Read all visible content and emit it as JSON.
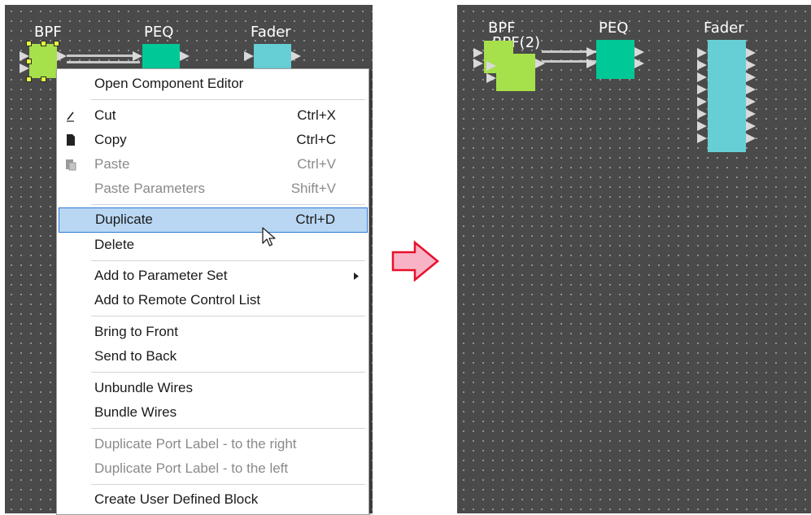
{
  "left_canvas": {
    "blocks": [
      {
        "id": "bpf",
        "label": "BPF",
        "color": "#a6e04a"
      },
      {
        "id": "peq",
        "label": "PEQ",
        "color": "#00c896"
      },
      {
        "id": "fader",
        "label": "Fader",
        "color": "#66cfd6"
      }
    ]
  },
  "context_menu": {
    "items": [
      {
        "label": "Open Component Editor",
        "shortcut": "",
        "disabled": false,
        "icon": ""
      },
      {
        "label": "Cut",
        "shortcut": "Ctrl+X",
        "disabled": false,
        "icon": "cut-icon"
      },
      {
        "label": "Copy",
        "shortcut": "Ctrl+C",
        "disabled": false,
        "icon": "copy-icon"
      },
      {
        "label": "Paste",
        "shortcut": "Ctrl+V",
        "disabled": true,
        "icon": "paste-icon"
      },
      {
        "label": "Paste Parameters",
        "shortcut": "Shift+V",
        "disabled": true,
        "icon": ""
      },
      {
        "label": "Duplicate",
        "shortcut": "Ctrl+D",
        "disabled": false,
        "highlighted": true,
        "icon": ""
      },
      {
        "label": "Delete",
        "shortcut": "",
        "disabled": false,
        "icon": ""
      },
      {
        "label": "Add to Parameter Set",
        "shortcut": "",
        "disabled": false,
        "submenu": true,
        "icon": "submenu-arrow-icon"
      },
      {
        "label": "Add to Remote Control List",
        "shortcut": "",
        "disabled": false,
        "icon": ""
      },
      {
        "label": "Bring to Front",
        "shortcut": "",
        "disabled": false,
        "icon": ""
      },
      {
        "label": "Send to Back",
        "shortcut": "",
        "disabled": false,
        "icon": ""
      },
      {
        "label": "Unbundle Wires",
        "shortcut": "",
        "disabled": false,
        "icon": ""
      },
      {
        "label": "Bundle Wires",
        "shortcut": "",
        "disabled": false,
        "icon": ""
      },
      {
        "label": "Duplicate Port Label - to the right",
        "shortcut": "",
        "disabled": true,
        "icon": ""
      },
      {
        "label": "Duplicate Port Label - to the left",
        "shortcut": "",
        "disabled": true,
        "icon": ""
      },
      {
        "label": "Create User Defined Block",
        "shortcut": "",
        "disabled": false,
        "icon": ""
      }
    ]
  },
  "right_canvas": {
    "blocks": [
      {
        "id": "bpf",
        "label": "BPF",
        "color": "#a6e04a"
      },
      {
        "id": "bpf2",
        "label": "BPF(2)",
        "color": "#a6e04a"
      },
      {
        "id": "peq",
        "label": "PEQ",
        "color": "#00c896"
      },
      {
        "id": "fader",
        "label": "Fader",
        "color": "#66cfd6"
      }
    ]
  },
  "colors": {
    "canvas_bg": "#4a4a4a",
    "highlight": "#b9d7f3",
    "arrow_fill": "#f8b4c6",
    "arrow_stroke": "#e8102c"
  }
}
